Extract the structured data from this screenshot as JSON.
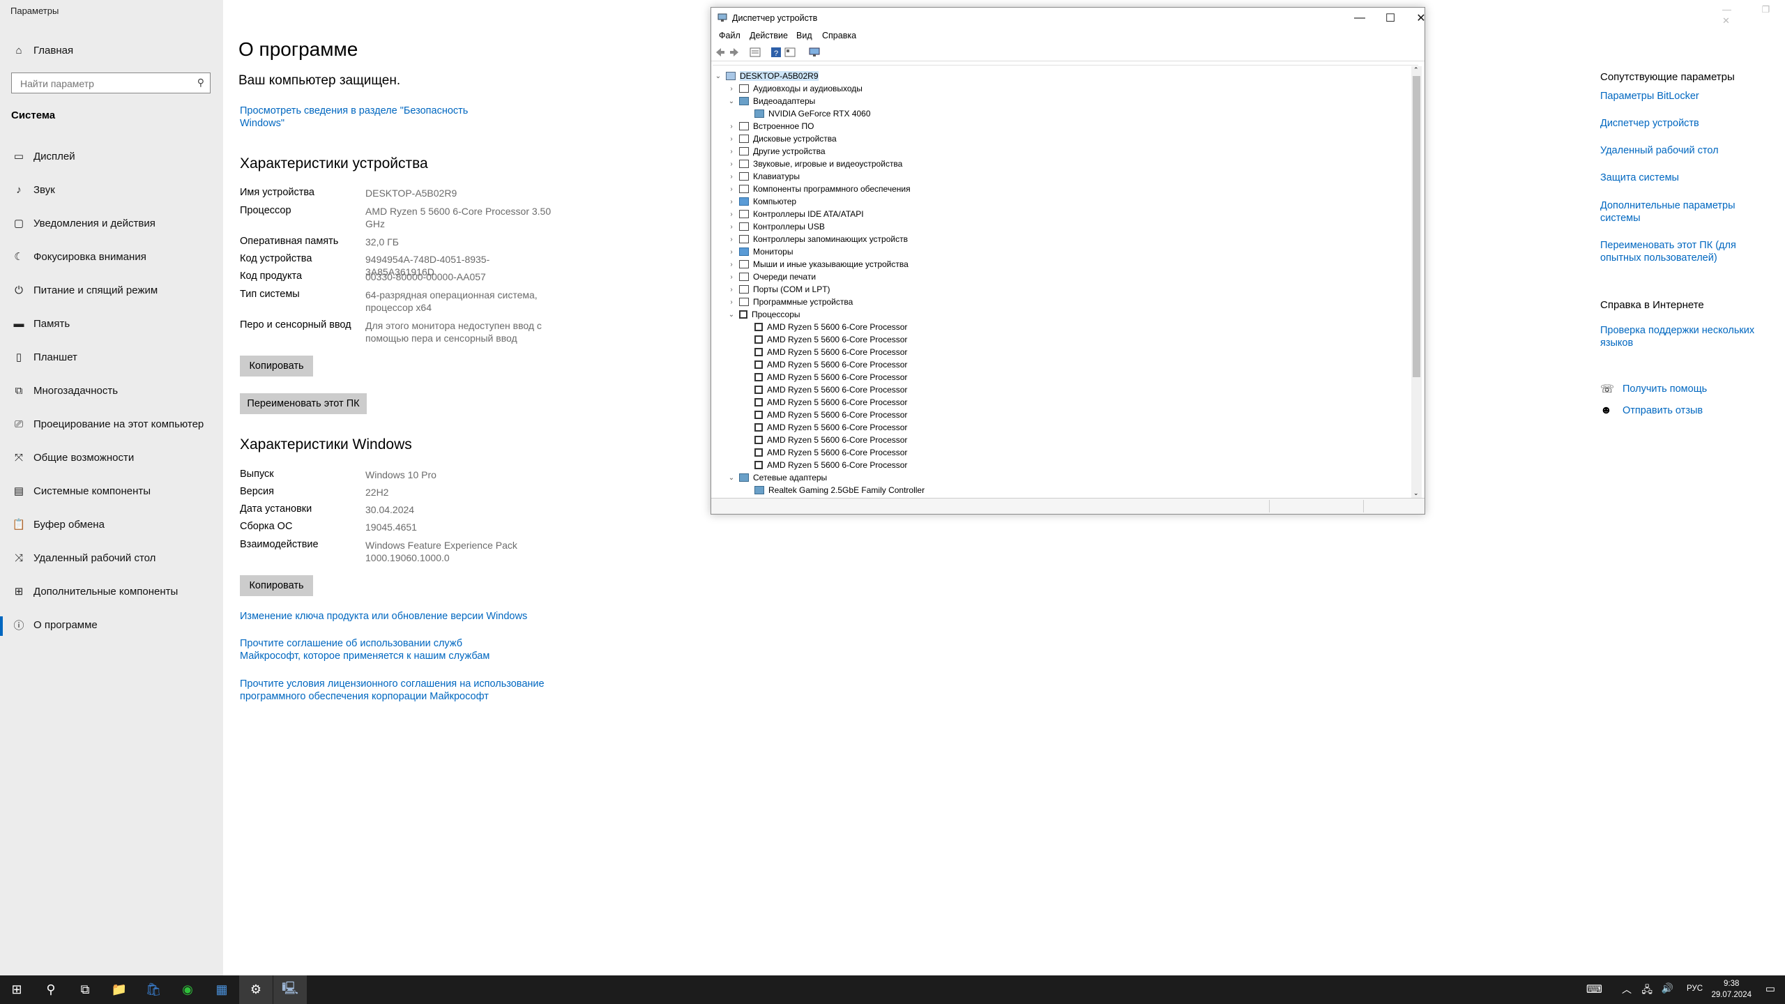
{
  "settings": {
    "app_title": "Параметры",
    "home_label": "Главная",
    "search_placeholder": "Найти параметр",
    "section": "Система",
    "nav": [
      {
        "label": "Дисплей",
        "icon": "display-icon"
      },
      {
        "label": "Звук",
        "icon": "sound-icon"
      },
      {
        "label": "Уведомления и действия",
        "icon": "notifications-icon"
      },
      {
        "label": "Фокусировка внимания",
        "icon": "focus-assist-icon"
      },
      {
        "label": "Питание и спящий режим",
        "icon": "power-icon"
      },
      {
        "label": "Память",
        "icon": "storage-icon"
      },
      {
        "label": "Планшет",
        "icon": "tablet-icon"
      },
      {
        "label": "Многозадачность",
        "icon": "multitasking-icon"
      },
      {
        "label": "Проецирование на этот компьютер",
        "icon": "projecting-icon"
      },
      {
        "label": "Общие возможности",
        "icon": "shared-experiences-icon"
      },
      {
        "label": "Системные компоненты",
        "icon": "system-components-icon"
      },
      {
        "label": "Буфер обмена",
        "icon": "clipboard-icon"
      },
      {
        "label": "Удаленный рабочий стол",
        "icon": "remote-desktop-icon"
      },
      {
        "label": "Дополнительные компоненты",
        "icon": "optional-features-icon"
      },
      {
        "label": "О программе",
        "icon": "about-icon",
        "active": true
      }
    ],
    "main": {
      "title": "О программе",
      "protected": "Ваш компьютер защищен.",
      "security_link": "Просмотреть сведения в разделе \"Безопасность Windows\"",
      "device_specs_title": "Характеристики устройства",
      "device_specs": [
        {
          "label": "Имя устройства",
          "value": "DESKTOP-A5B02R9"
        },
        {
          "label": "Процессор",
          "value": "AMD Ryzen 5 5600 6-Core Processor 3.50 GHz"
        },
        {
          "label": "Оперативная память",
          "value": "32,0 ГБ"
        },
        {
          "label": "Код устройства",
          "value": "9494954A-748D-4051-8935-3A85A361916D"
        },
        {
          "label": "Код продукта",
          "value": "00330-80000-00000-AA057"
        },
        {
          "label": "Тип системы",
          "value": "64-разрядная операционная система, процессор x64"
        },
        {
          "label": "Перо и сенсорный ввод",
          "value": "Для этого монитора недоступен ввод с помощью пера и сенсорный ввод"
        }
      ],
      "copy_button": "Копировать",
      "rename_button": "Переименовать этот ПК",
      "windows_specs_title": "Характеристики Windows",
      "windows_specs": [
        {
          "label": "Выпуск",
          "value": "Windows 10 Pro"
        },
        {
          "label": "Версия",
          "value": "22H2"
        },
        {
          "label": "Дата установки",
          "value": "30.04.2024"
        },
        {
          "label": "Сборка ОС",
          "value": "19045.4651"
        },
        {
          "label": "Взаимодействие",
          "value": "Windows Feature Experience Pack 1000.19060.1000.0"
        }
      ],
      "copy_button_2": "Копировать",
      "links": [
        "Изменение ключа продукта или обновление версии Windows",
        "Прочтите соглашение об использовании служб Майкрософт, которое применяется к нашим службам",
        "Прочтите условия лицензионного соглашения на использование программного обеспечения корпорации Майкрософт"
      ]
    },
    "right": {
      "related_title": "Сопутствующие параметры",
      "related_links": [
        "Параметры BitLocker",
        "Диспетчер устройств",
        "Удаленный рабочий стол",
        "Защита системы",
        "Дополнительные параметры системы",
        "Переименовать этот ПК (для опытных пользователей)"
      ],
      "web_help_title": "Справка в Интернете",
      "web_help_link": "Проверка поддержки нескольких языков",
      "get_help": "Получить помощь",
      "feedback": "Отправить отзыв"
    }
  },
  "devmgr": {
    "title": "Диспетчер устройств",
    "menu": [
      "Файл",
      "Действие",
      "Вид",
      "Справка"
    ],
    "root": "DESKTOP-A5B02R9",
    "tree": [
      {
        "label": "Аудиовходы и аудиовыходы",
        "level": 1,
        "state": "collapsed",
        "icon": "audio-icon"
      },
      {
        "label": "Видеоадаптеры",
        "level": 1,
        "state": "expanded",
        "icon": "display-adapter-icon"
      },
      {
        "label": "NVIDIA GeForce RTX 4060",
        "level": 2,
        "state": "leaf",
        "icon": "gpu-icon"
      },
      {
        "label": "Встроенное ПО",
        "level": 1,
        "state": "collapsed",
        "icon": "firmware-icon"
      },
      {
        "label": "Дисковые устройства",
        "level": 1,
        "state": "collapsed",
        "icon": "disk-icon"
      },
      {
        "label": "Другие устройства",
        "level": 1,
        "state": "collapsed",
        "icon": "other-devices-icon"
      },
      {
        "label": "Звуковые, игровые и видеоустройства",
        "level": 1,
        "state": "collapsed",
        "icon": "sound-device-icon"
      },
      {
        "label": "Клавиатуры",
        "level": 1,
        "state": "collapsed",
        "icon": "keyboard-icon"
      },
      {
        "label": "Компоненты программного обеспечения",
        "level": 1,
        "state": "collapsed",
        "icon": "software-component-icon"
      },
      {
        "label": "Компьютер",
        "level": 1,
        "state": "collapsed",
        "icon": "computer-icon"
      },
      {
        "label": "Контроллеры IDE ATA/ATAPI",
        "level": 1,
        "state": "collapsed",
        "icon": "ide-controller-icon"
      },
      {
        "label": "Контроллеры USB",
        "level": 1,
        "state": "collapsed",
        "icon": "usb-icon"
      },
      {
        "label": "Контроллеры запоминающих устройств",
        "level": 1,
        "state": "collapsed",
        "icon": "storage-controller-icon"
      },
      {
        "label": "Мониторы",
        "level": 1,
        "state": "collapsed",
        "icon": "monitor-icon"
      },
      {
        "label": "Мыши и иные указывающие устройства",
        "level": 1,
        "state": "collapsed",
        "icon": "mouse-icon"
      },
      {
        "label": "Очереди печати",
        "level": 1,
        "state": "collapsed",
        "icon": "print-queue-icon"
      },
      {
        "label": "Порты (COM и LPT)",
        "level": 1,
        "state": "collapsed",
        "icon": "port-icon"
      },
      {
        "label": "Программные устройства",
        "level": 1,
        "state": "collapsed",
        "icon": "software-device-icon"
      },
      {
        "label": "Процессоры",
        "level": 1,
        "state": "expanded",
        "icon": "processor-icon"
      },
      {
        "label": "AMD Ryzen 5 5600 6-Core Processor",
        "level": 2,
        "state": "leaf",
        "icon": "cpu-icon"
      },
      {
        "label": "AMD Ryzen 5 5600 6-Core Processor",
        "level": 2,
        "state": "leaf",
        "icon": "cpu-icon"
      },
      {
        "label": "AMD Ryzen 5 5600 6-Core Processor",
        "level": 2,
        "state": "leaf",
        "icon": "cpu-icon"
      },
      {
        "label": "AMD Ryzen 5 5600 6-Core Processor",
        "level": 2,
        "state": "leaf",
        "icon": "cpu-icon"
      },
      {
        "label": "AMD Ryzen 5 5600 6-Core Processor",
        "level": 2,
        "state": "leaf",
        "icon": "cpu-icon"
      },
      {
        "label": "AMD Ryzen 5 5600 6-Core Processor",
        "level": 2,
        "state": "leaf",
        "icon": "cpu-icon"
      },
      {
        "label": "AMD Ryzen 5 5600 6-Core Processor",
        "level": 2,
        "state": "leaf",
        "icon": "cpu-icon"
      },
      {
        "label": "AMD Ryzen 5 5600 6-Core Processor",
        "level": 2,
        "state": "leaf",
        "icon": "cpu-icon"
      },
      {
        "label": "AMD Ryzen 5 5600 6-Core Processor",
        "level": 2,
        "state": "leaf",
        "icon": "cpu-icon"
      },
      {
        "label": "AMD Ryzen 5 5600 6-Core Processor",
        "level": 2,
        "state": "leaf",
        "icon": "cpu-icon"
      },
      {
        "label": "AMD Ryzen 5 5600 6-Core Processor",
        "level": 2,
        "state": "leaf",
        "icon": "cpu-icon"
      },
      {
        "label": "AMD Ryzen 5 5600 6-Core Processor",
        "level": 2,
        "state": "leaf",
        "icon": "cpu-icon"
      },
      {
        "label": "Сетевые адаптеры",
        "level": 1,
        "state": "expanded",
        "icon": "network-adapter-icon"
      },
      {
        "label": "Realtek Gaming 2.5GbE Family Controller",
        "level": 2,
        "state": "leaf",
        "icon": "nic-icon"
      }
    ]
  },
  "taskbar": {
    "apps": [
      "start-icon",
      "search-icon",
      "task-view-icon",
      "file-explorer-icon",
      "store-icon",
      "xbox-icon",
      "calculator-icon",
      "settings-icon",
      "device-manager-icon"
    ],
    "lang": "РУС",
    "time": "9:38",
    "date": "29.07.2024"
  }
}
